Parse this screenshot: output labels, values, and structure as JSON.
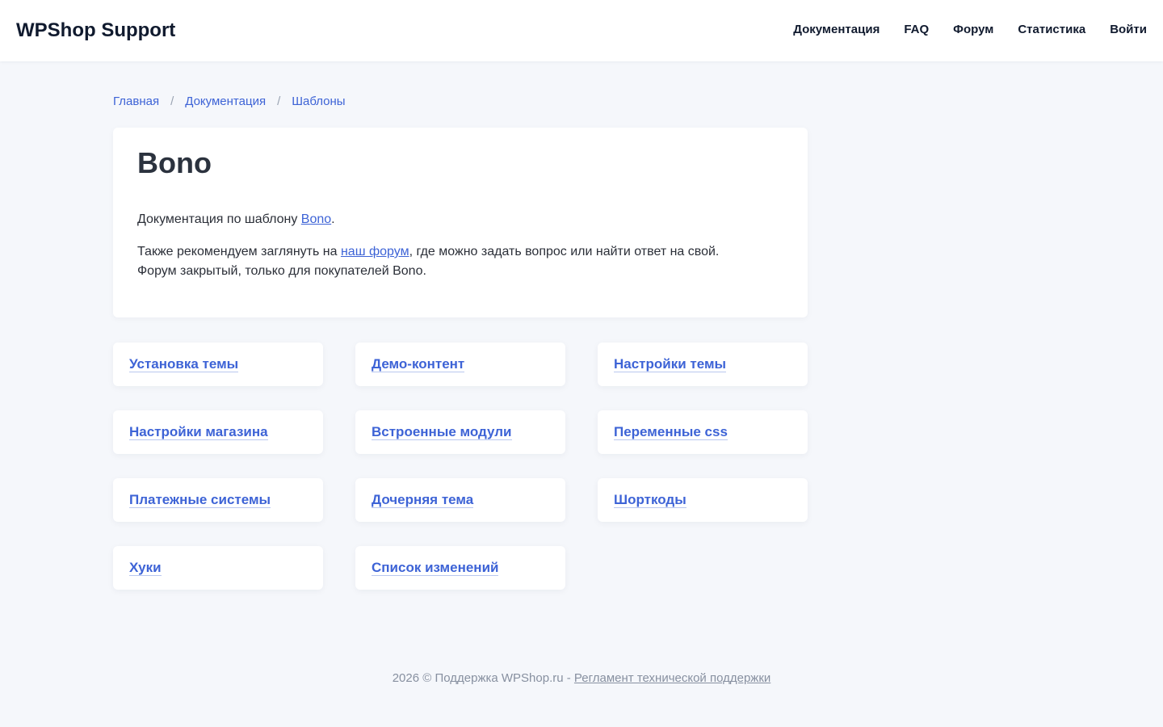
{
  "header": {
    "logo": "WPShop Support",
    "nav": [
      {
        "label": "Документация"
      },
      {
        "label": "FAQ"
      },
      {
        "label": "Форум"
      },
      {
        "label": "Статистика"
      },
      {
        "label": "Войти"
      }
    ]
  },
  "breadcrumb": {
    "items": [
      "Главная",
      "Документация",
      "Шаблоны"
    ],
    "separator": "/"
  },
  "intro": {
    "title": "Bono",
    "p1_prefix": "Документация по шаблону ",
    "p1_link": "Bono",
    "p1_suffix": ".",
    "p2_prefix": "Также рекомендуем заглянуть на ",
    "p2_link": "наш форум",
    "p2_suffix": ", где можно задать вопрос или найти ответ на свой.",
    "p2_line2": "Форум закрытый, только для покупателей Bono."
  },
  "cards": [
    {
      "label": "Установка темы"
    },
    {
      "label": "Демо-контент"
    },
    {
      "label": "Настройки темы"
    },
    {
      "label": "Настройки магазина"
    },
    {
      "label": "Встроенные модули"
    },
    {
      "label": "Переменные css"
    },
    {
      "label": "Платежные системы"
    },
    {
      "label": "Дочерняя тема"
    },
    {
      "label": "Шорткоды"
    },
    {
      "label": "Хуки"
    },
    {
      "label": "Список изменений"
    }
  ],
  "footer": {
    "text": "2026 © Поддержка WPShop.ru - ",
    "link": "Регламент технической поддержки"
  },
  "colors": {
    "accent": "#3d63d6",
    "background": "#f5f7fb",
    "text": "#2b2f38"
  }
}
